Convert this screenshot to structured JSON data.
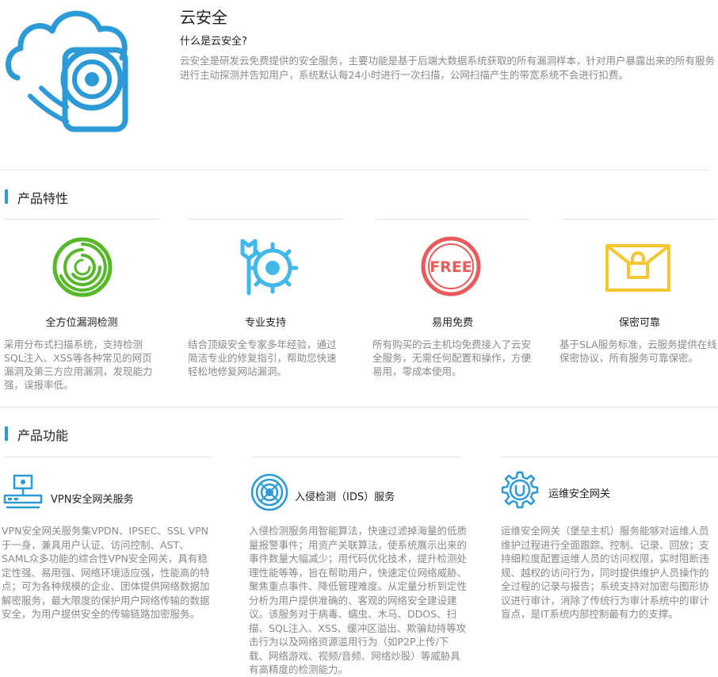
{
  "header": {
    "title": "云安全",
    "subtitle": "什么是云安全?",
    "intro": "云安全是研发云免费提供的安全服务，主要功能是基于后端大数据系统获取的所有漏洞样本，针对用户暴露出来的所有服务进行主动探测并告知用户，系统默认每24小时进行一次扫描，公网扫描产生的带宽系统不会进行扣费。"
  },
  "features": {
    "heading": "产品特性",
    "items": [
      {
        "name": "全方位漏洞检测",
        "desc": "采用分布式扫描系统，支持检测SQL注入、XSS等各种常见的网页漏洞及第三方应用漏洞，发现能力强，误报率低。",
        "icon": "scan-rings-icon"
      },
      {
        "name": "专业支持",
        "desc": "结合顶级安全专家多年经验，通过简洁专业的修复指引，帮助您快速轻松地修复网站漏洞。",
        "icon": "wrench-gear-icon"
      },
      {
        "name": "易用免费",
        "desc": "所有购买的云主机均免费接入了云安全服务，无需任何配置和操作，方便易用，零成本使用。",
        "icon": "free-badge-icon"
      },
      {
        "name": "保密可靠",
        "desc": "基于SLA服务标准，云服务提供在线保密协议，所有服务可靠保密。",
        "icon": "lock-envelope-icon"
      }
    ]
  },
  "functions": {
    "heading": "产品功能",
    "items": [
      {
        "name": "VPN安全网关服务",
        "desc": "VPN安全网关服务集VPDN、IPSEC、SSL VPN于一身，兼具用户认证、访问控制、AST、SAML众多功能的综合性VPN安全网关，具有稳定性强、易用强、网络环境适应强，性能高的特点；可为各种规模的企业、团体提供网络数据加解密服务，最大限度的保护用户网络传输的数据安全，为用户提供安全的传输链路加密服务。",
        "icon": "vpn-gateway-icon"
      },
      {
        "name": "入侵检测（IDS）服务",
        "desc": "入侵检测服务用智能算法，快速过滤掉海量的低质量报警事件；用资产关联算法，使系统展示出来的事件数量大幅减少；用代码优化技术，提升检测处理性能等等，旨在帮助用户，快速定位网络威胁、聚焦重点事件、降低管理难度。从定量分析到定性分析为用户提供准确的、客观的网络安全建设建议。该服务对于病毒、蠕虫、木马、DDOS、扫描、SQL注入、XSS、缓冲区溢出、欺骗劫持等攻击行为以及网络资源滥用行为（如P2P上传/下载、网络游戏、视频/音频、网络炒股）等威胁具有高精度的检测能力。",
        "icon": "ids-radar-icon"
      },
      {
        "name": "运维安全网关",
        "desc": "运维安全网关（堡垒主机）服务能够对运维人员维护过程进行全面跟踪、控制、记录、回放；支持细粒度配置运维人员的访问权限，实时阻断违规、越权的访问行为，同时提供维护人员操作的全过程的记录与报告；系统支持对加密与图形协议进行审计，消除了传统行为审计系统中的审计盲点，是IT系统内部控制最有力的支撑。",
        "icon": "ops-gear-icon"
      }
    ]
  },
  "colors": {
    "accent": "#2b9ad6",
    "green": "#57b82a",
    "cyan": "#42b7e9",
    "red": "#eb5a5a",
    "yellow": "#f3c730"
  }
}
